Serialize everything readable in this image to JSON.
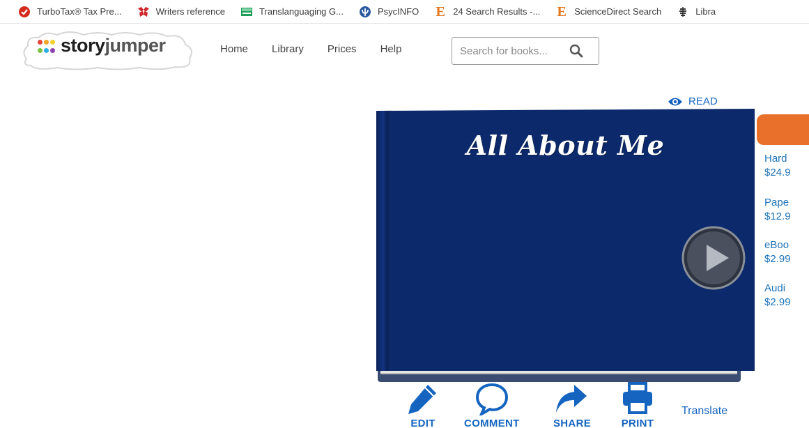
{
  "bookmarks": [
    {
      "label": "TurboTax® Tax Pre...",
      "icon": "turbotax-icon",
      "color": "#d52b1e"
    },
    {
      "label": "Writers reference",
      "icon": "writers-reference-icon",
      "color": "#d0262a"
    },
    {
      "label": "Translanguaging G...",
      "icon": "translanguaging-icon",
      "color": "#1e9e57"
    },
    {
      "label": "PsycINFO",
      "icon": "psycinfo-icon",
      "color": "#2b5aa0"
    },
    {
      "label": "24 Search Results -...",
      "icon": "ebsco-e-icon",
      "color": "#e4761c"
    },
    {
      "label": "ScienceDirect Search",
      "icon": "ebsco-e-icon",
      "color": "#e4761c"
    },
    {
      "label": "Libra",
      "icon": "library-icon",
      "color": "#333333"
    }
  ],
  "header": {
    "logo_story": "story",
    "logo_jumper": "jumper",
    "nav": [
      "Home",
      "Library",
      "Prices",
      "Help"
    ],
    "search_placeholder": "Search for books..."
  },
  "book": {
    "read_label": "READ",
    "title": "All About Me",
    "cover_color": "#0c2a6b"
  },
  "purchase": {
    "accent": "#e8702a",
    "options": [
      {
        "name": "Hard",
        "price": "$24.9"
      },
      {
        "name": "Pape",
        "price": "$12.9"
      },
      {
        "name": "eBoo",
        "price": "$2.99"
      },
      {
        "name": "Audi",
        "price": "$2.99"
      }
    ]
  },
  "tools": {
    "edit": "EDIT",
    "comment": "COMMENT",
    "share": "SHARE",
    "print": "PRINT",
    "translate": "Translate"
  },
  "colors": {
    "link_blue": "#1565c0",
    "price_blue": "#1c73b8"
  }
}
